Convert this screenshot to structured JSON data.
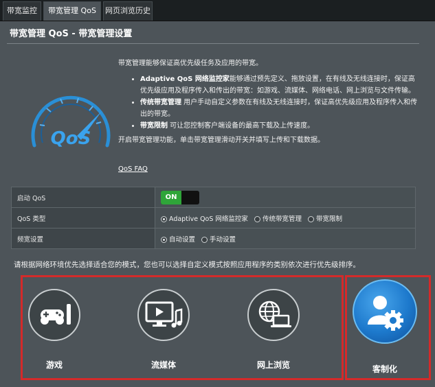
{
  "tabs": [
    {
      "label": "带宽监控"
    },
    {
      "label": "带宽管理 QoS"
    },
    {
      "label": "网页浏览历史"
    }
  ],
  "page_title": "带宽管理 QoS - 带宽管理设置",
  "gauge_text": "QoS",
  "intro": "带宽管理能够保证高优先级任务及应用的带宽。",
  "bullets": [
    {
      "title": "Adaptive QoS 网络监控家",
      "text": "能够通过预先定义、拖放设置，在有线及无线连接时，保证高优先级应用及程序传入和传出的带宽：如游戏、流媒体、网络电话、网上浏览与文件传输。"
    },
    {
      "title": "传统带宽管理",
      "text": " 用户手动自定义参数在有线及无线连接时，保证高优先级应用及程序传入和传出的带宽。"
    },
    {
      "title": "带宽限制",
      "text": " 可让您控制客户端设备的最高下载及上传速度。"
    }
  ],
  "enable_hint": "开启带宽管理功能，单击带宽管理滑动开关并填写上传和下载数据。",
  "faq_link": "QoS FAQ",
  "settings": {
    "enable_label": "启动 QoS",
    "enable_toggle": "ON",
    "type_label": "QoS 类型",
    "type_options": [
      "Adaptive QoS 网络监控家",
      "传统带宽管理",
      "带宽限制"
    ],
    "bandwidth_label": "频宽设置",
    "bandwidth_options": [
      "自动设置",
      "手动设置"
    ]
  },
  "mode_hint": "请根据网络环境优先选择适合您的模式，您也可以选择自定义模式按照应用程序的类别依次进行优先级排序。",
  "modes": [
    {
      "label": "游戏",
      "icon": "gamepad-icon"
    },
    {
      "label": "流媒体",
      "icon": "media-player-icon"
    },
    {
      "label": "网上浏览",
      "icon": "web-browsing-icon"
    },
    {
      "label": "客制化",
      "icon": "custom-user-gear-icon"
    }
  ],
  "colors": {
    "toggle_on": "#2fa539",
    "highlight_frame": "#d42a2a",
    "custom_blue": "#1d79cc",
    "gauge_blue": "#2a8fd6"
  }
}
